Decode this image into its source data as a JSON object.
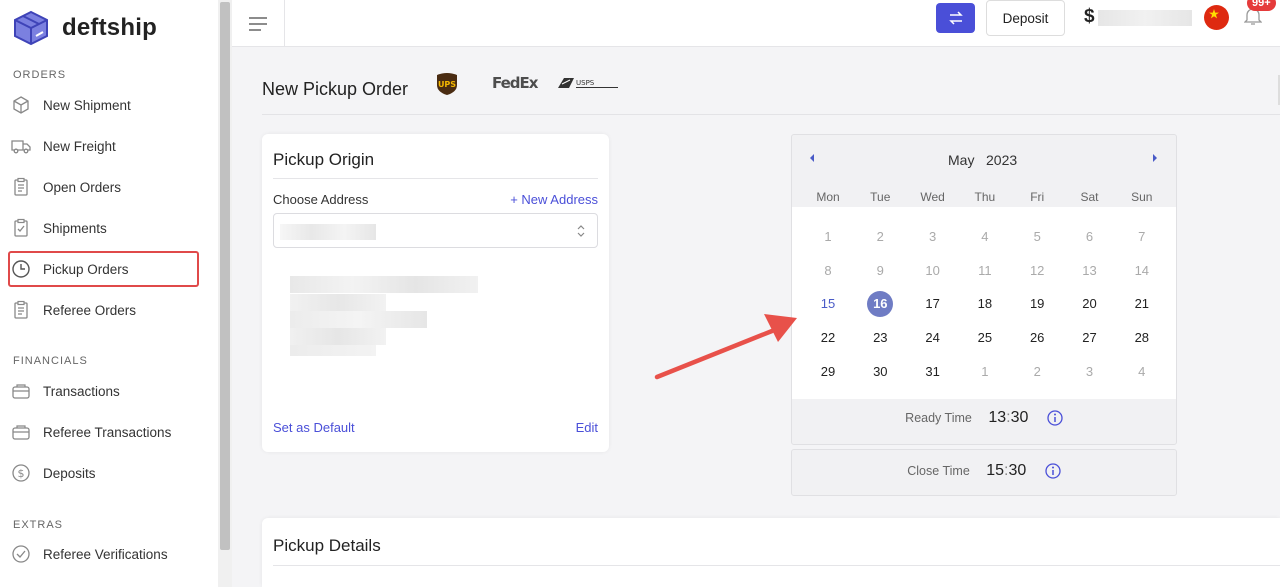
{
  "brand": {
    "name": "deftship",
    "accent": "#4a4fd8"
  },
  "sidebar": {
    "sections": [
      {
        "title": "ORDERS",
        "items": [
          {
            "label": "New Shipment",
            "icon": "box-icon"
          },
          {
            "label": "New Freight",
            "icon": "truck-icon"
          },
          {
            "label": "Open Orders",
            "icon": "clipboard-icon"
          },
          {
            "label": "Shipments",
            "icon": "clipboard-check-icon"
          },
          {
            "label": "Pickup Orders",
            "icon": "clock-icon",
            "active": true
          },
          {
            "label": "Referee Orders",
            "icon": "clipboard-icon"
          }
        ]
      },
      {
        "title": "FINANCIALS",
        "items": [
          {
            "label": "Transactions",
            "icon": "wallet-icon"
          },
          {
            "label": "Referee Transactions",
            "icon": "wallet-icon"
          },
          {
            "label": "Deposits",
            "icon": "dollar-circle-icon"
          }
        ]
      },
      {
        "title": "EXTRAS",
        "items": [
          {
            "label": "Referee Verifications",
            "icon": "check-circle-icon"
          }
        ]
      }
    ]
  },
  "topbar": {
    "deposit_label": "Deposit",
    "currency_symbol": "$",
    "notification_badge": "99+"
  },
  "page": {
    "title": "New Pickup Order",
    "carriers": [
      "UPS",
      "FedEx",
      "USPS"
    ]
  },
  "origin": {
    "title": "Pickup Origin",
    "choose_label": "Choose Address",
    "new_address_label": "New Address",
    "set_default_label": "Set as Default",
    "edit_label": "Edit"
  },
  "calendar": {
    "month": "May",
    "year": "2023",
    "weekdays": [
      "Mon",
      "Tue",
      "Wed",
      "Thu",
      "Fri",
      "Sat",
      "Sun"
    ],
    "weeks": [
      [
        [
          "1",
          "muted"
        ],
        [
          "2",
          "muted"
        ],
        [
          "3",
          "muted"
        ],
        [
          "4",
          "muted"
        ],
        [
          "5",
          "muted"
        ],
        [
          "6",
          "muted"
        ],
        [
          "7",
          "muted"
        ]
      ],
      [
        [
          "8",
          "muted"
        ],
        [
          "9",
          "muted"
        ],
        [
          "10",
          "muted"
        ],
        [
          "11",
          "muted"
        ],
        [
          "12",
          "muted"
        ],
        [
          "13",
          "muted"
        ],
        [
          "14",
          "muted"
        ]
      ],
      [
        [
          "15",
          "today"
        ],
        [
          "16",
          "selected"
        ],
        [
          "17",
          ""
        ],
        [
          "18",
          ""
        ],
        [
          "19",
          ""
        ],
        [
          "20",
          ""
        ],
        [
          "21",
          ""
        ]
      ],
      [
        [
          "22",
          ""
        ],
        [
          "23",
          ""
        ],
        [
          "24",
          ""
        ],
        [
          "25",
          ""
        ],
        [
          "26",
          ""
        ],
        [
          "27",
          ""
        ],
        [
          "28",
          ""
        ]
      ],
      [
        [
          "29",
          ""
        ],
        [
          "30",
          ""
        ],
        [
          "31",
          ""
        ],
        [
          "1",
          "muted"
        ],
        [
          "2",
          "muted"
        ],
        [
          "3",
          "muted"
        ],
        [
          "4",
          "muted"
        ]
      ]
    ],
    "ready_time": {
      "label": "Ready Time",
      "hour": "13",
      "minute": "30"
    },
    "close_time": {
      "label": "Close Time",
      "hour": "15",
      "minute": "30"
    }
  },
  "details": {
    "title": "Pickup Details"
  }
}
